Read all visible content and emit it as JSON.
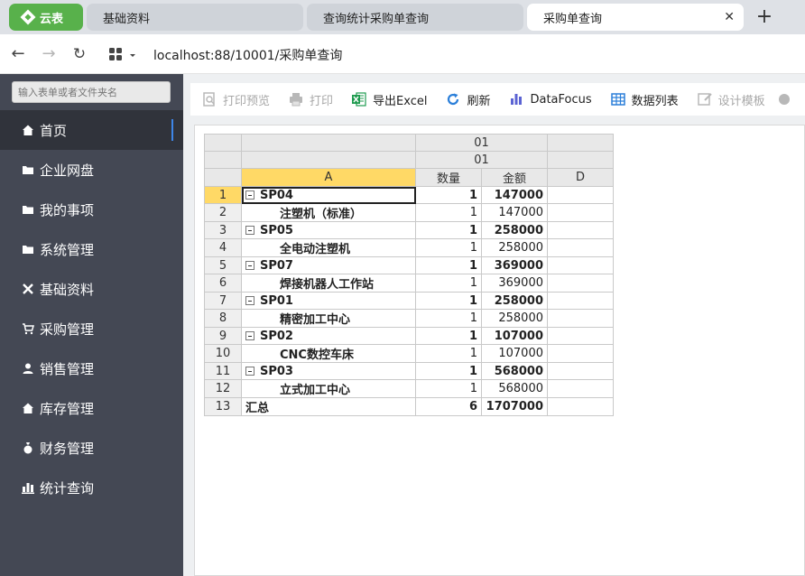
{
  "browser": {
    "app_tab": "云表",
    "tabs": [
      {
        "label": "基础资料"
      },
      {
        "label": "查询统计采购单查询"
      },
      {
        "label": "采购单查询"
      }
    ],
    "close_glyph": "✕",
    "new_tab_glyph": "+",
    "url": "localhost:88/10001/采购单查询"
  },
  "sidebar": {
    "search_placeholder": "输入表单或者文件夹名",
    "items": [
      {
        "label": "首页",
        "icon": "home-icon"
      },
      {
        "label": "企业网盘",
        "icon": "folder-icon"
      },
      {
        "label": "我的事项",
        "icon": "folder-icon"
      },
      {
        "label": "系统管理",
        "icon": "folder-icon"
      },
      {
        "label": "基础资料",
        "icon": "tools-icon"
      },
      {
        "label": "采购管理",
        "icon": "cart-icon"
      },
      {
        "label": "销售管理",
        "icon": "user-icon"
      },
      {
        "label": "库存管理",
        "icon": "home-icon"
      },
      {
        "label": "财务管理",
        "icon": "moneybag-icon"
      },
      {
        "label": "统计查询",
        "icon": "bar-chart-icon"
      }
    ]
  },
  "toolbar": {
    "print_preview": "打印预览",
    "print": "打印",
    "export_excel": "导出Excel",
    "refresh": "刷新",
    "datafocus": "DataFocus",
    "data_list": "数据列表",
    "design_template": "设计模板"
  },
  "grid": {
    "header1": "01",
    "header2": "01",
    "col_a": "A",
    "col_qty": "数量",
    "col_amount": "金额",
    "col_d": "D",
    "rows": [
      {
        "n": "1",
        "name": "SP04",
        "qty": "1",
        "amount": "147000"
      },
      {
        "n": "2",
        "name": "注塑机（标准）",
        "qty": "1",
        "amount": "147000"
      },
      {
        "n": "3",
        "name": "SP05",
        "qty": "1",
        "amount": "258000"
      },
      {
        "n": "4",
        "name": "全电动注塑机",
        "qty": "1",
        "amount": "258000"
      },
      {
        "n": "5",
        "name": "SP07",
        "qty": "1",
        "amount": "369000"
      },
      {
        "n": "6",
        "name": "焊接机器人工作站",
        "qty": "1",
        "amount": "369000"
      },
      {
        "n": "7",
        "name": "SP01",
        "qty": "1",
        "amount": "258000"
      },
      {
        "n": "8",
        "name": "精密加工中心",
        "qty": "1",
        "amount": "258000"
      },
      {
        "n": "9",
        "name": "SP02",
        "qty": "1",
        "amount": "107000"
      },
      {
        "n": "10",
        "name": "CNC数控车床",
        "qty": "1",
        "amount": "107000"
      },
      {
        "n": "11",
        "name": "SP03",
        "qty": "1",
        "amount": "568000"
      },
      {
        "n": "12",
        "name": "立式加工中心",
        "qty": "1",
        "amount": "568000"
      },
      {
        "n": "13",
        "name": "汇总",
        "qty": "6",
        "amount": "1707000"
      }
    ]
  }
}
